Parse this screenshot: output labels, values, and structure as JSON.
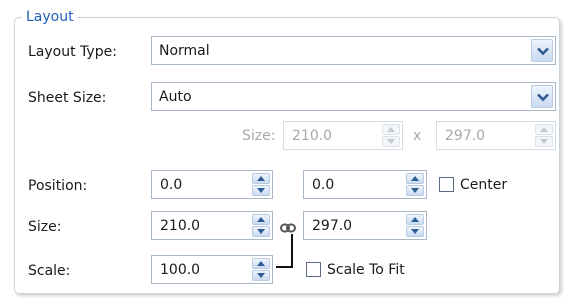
{
  "panel": {
    "title": "Layout"
  },
  "layout_type": {
    "label": "Layout Type:",
    "value": "Normal"
  },
  "sheet_size": {
    "label": "Sheet Size:",
    "value": "Auto",
    "size_label": "Size:",
    "width": "210.0",
    "separator": "x",
    "height": "297.0"
  },
  "position": {
    "label": "Position:",
    "x": "0.0",
    "y": "0.0",
    "center_label": "Center",
    "center_checked": false
  },
  "size": {
    "label": "Size:",
    "width": "210.0",
    "height": "297.0"
  },
  "scale": {
    "label": "Scale:",
    "value": "100.0",
    "fit_label": "Scale To Fit",
    "fit_checked": false
  },
  "colors": {
    "legend": "#1f5fb3",
    "border": "#a9b8c9",
    "disabled_text": "#a8a8a8"
  }
}
